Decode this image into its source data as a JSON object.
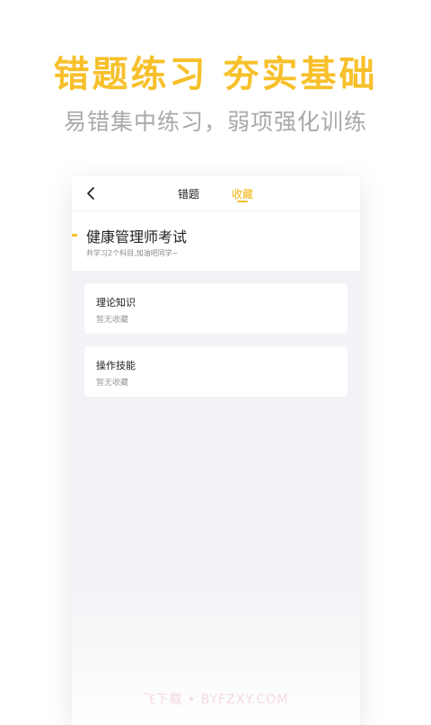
{
  "promo": {
    "headline": "错题练习  夯实基础",
    "subline": "易错集中练习，弱项强化训练"
  },
  "navbar": {
    "tabs": [
      {
        "label": "错题"
      },
      {
        "label": "收藏"
      }
    ],
    "active_tab": "收藏"
  },
  "exam": {
    "title": "健康管理师考试",
    "subtitle": "共学习2个科目,加油吧同学~"
  },
  "subjects": [
    {
      "name": "理论知识",
      "status": "暂无收藏"
    },
    {
      "name": "操作技能",
      "status": "暂无收藏"
    }
  ],
  "watermark": "飞下载 • BYFZXY.COM",
  "colors": {
    "accent": "#f7c02b",
    "background": "#f1f3f6",
    "subline": "#a9a9a9"
  },
  "icons": {
    "back": "chevron-left-icon"
  }
}
